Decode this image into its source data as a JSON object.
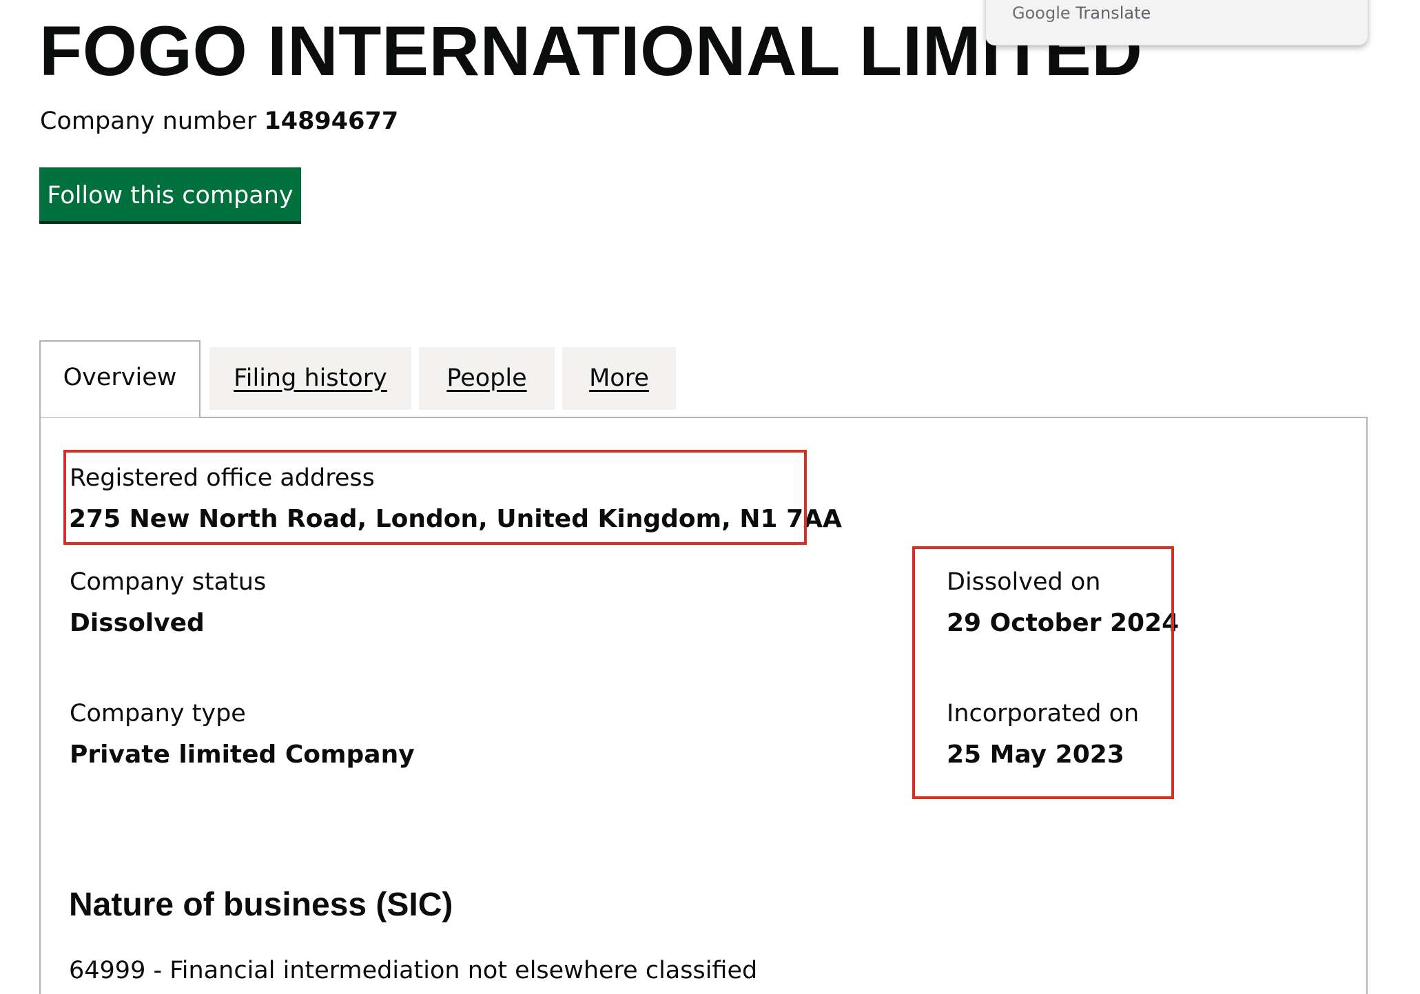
{
  "company": {
    "name": "FOGO INTERNATIONAL LIMITED",
    "number_label": "Company number",
    "number": "14894677"
  },
  "translate_widget": {
    "brand": "Google",
    "label": "Translate"
  },
  "actions": {
    "follow_label": "Follow this company"
  },
  "tabs": [
    {
      "label": "Overview",
      "active": true
    },
    {
      "label": "Filing history",
      "active": false
    },
    {
      "label": "People",
      "active": false
    },
    {
      "label": "More",
      "active": false
    }
  ],
  "overview": {
    "registered_office": {
      "label": "Registered office address",
      "value": "275 New North Road, London, United Kingdom, N1 7AA"
    },
    "status": {
      "label": "Company status",
      "value": "Dissolved"
    },
    "dissolved_on": {
      "label": "Dissolved on",
      "value": "29 October 2024"
    },
    "type": {
      "label": "Company type",
      "value": "Private limited Company"
    },
    "incorporated_on": {
      "label": "Incorporated on",
      "value": "25 May 2023"
    }
  },
  "nature_of_business": {
    "heading": "Nature of business (SIC)",
    "items": [
      "64999 - Financial intermediation not elsewhere classified"
    ]
  },
  "colors": {
    "primary_button": "#00703c",
    "highlight": "#d93025",
    "border": "#b1b4b6",
    "tab_background": "#f3f2f1"
  }
}
